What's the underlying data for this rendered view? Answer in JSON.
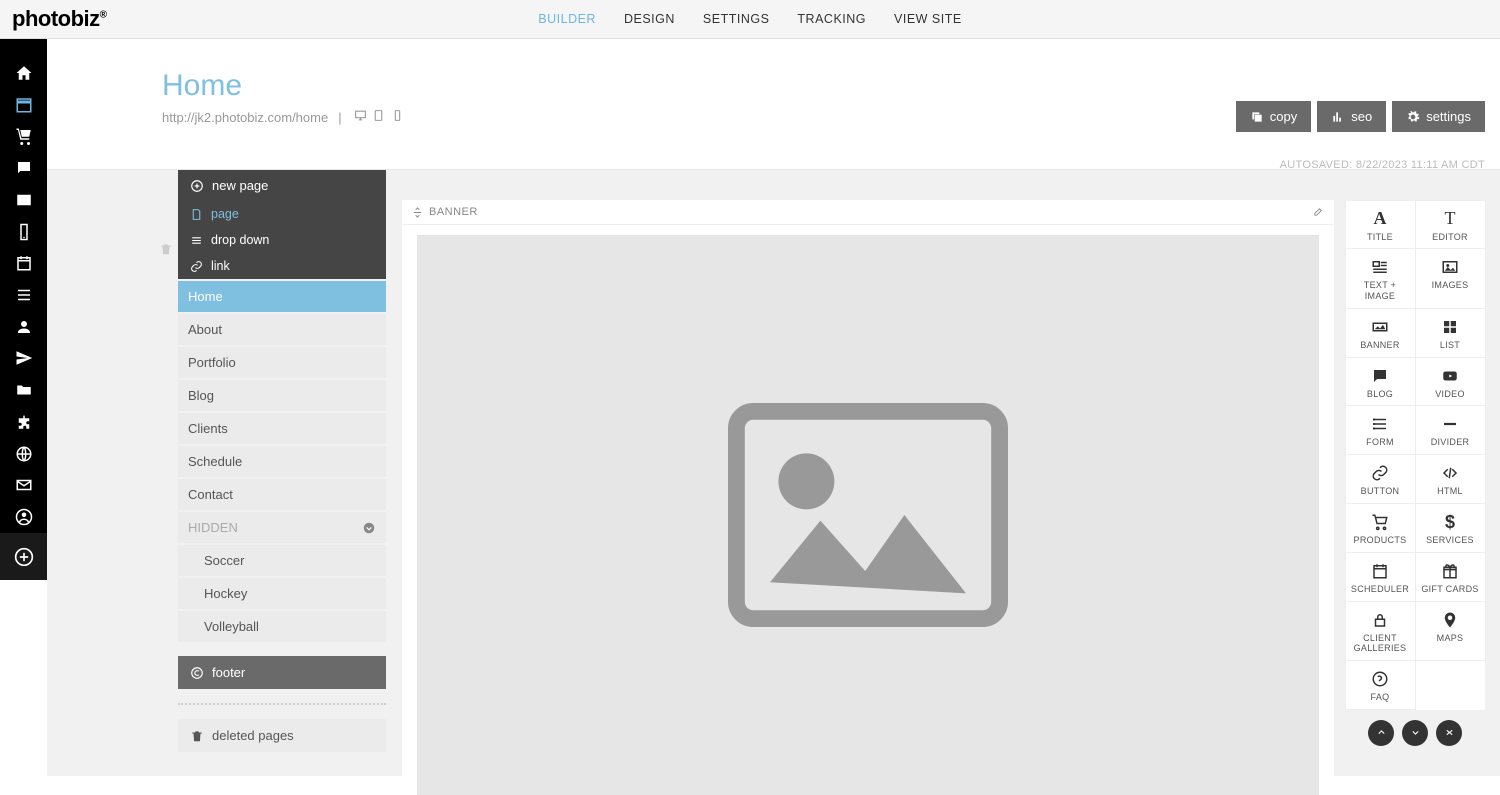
{
  "logo": "photobiz",
  "topnav": {
    "builder": "BUILDER",
    "design": "DESIGN",
    "settings": "SETTINGS",
    "tracking": "TRACKING",
    "view_site": "VIEW SITE"
  },
  "header": {
    "title": "Home",
    "url": "http://jk2.photobiz.com/home",
    "sep": "|",
    "copy": "copy",
    "seo": "seo",
    "settings": "settings",
    "autosave": "AUTOSAVED: 8/22/2023 11:11 AM CDT"
  },
  "newpage": {
    "label": "new page",
    "page": "page",
    "dropdown": "drop down",
    "link": "link"
  },
  "pages": {
    "home": "Home",
    "about": "About",
    "portfolio": "Portfolio",
    "blog": "Blog",
    "clients": "Clients",
    "schedule": "Schedule",
    "contact": "Contact",
    "hidden": "HIDDEN",
    "soccer": "Soccer",
    "hockey": "Hockey",
    "volleyball": "Volleyball"
  },
  "footer": "footer",
  "deleted": "deleted pages",
  "block": {
    "banner": "BANNER"
  },
  "elements": {
    "title": "TITLE",
    "editor": "EDITOR",
    "textimage": "TEXT +\nIMAGE",
    "images": "IMAGES",
    "banner": "BANNER",
    "list": "LIST",
    "blog": "BLOG",
    "video": "VIDEO",
    "form": "FORM",
    "divider": "DIVIDER",
    "button": "BUTTON",
    "html": "HTML",
    "products": "PRODUCTS",
    "services": "SERVICES",
    "scheduler": "SCHEDULER",
    "giftcards": "GIFT CARDS",
    "clientgalleries": "CLIENT\nGALLERIES",
    "maps": "MAPS",
    "faq": "FAQ"
  }
}
